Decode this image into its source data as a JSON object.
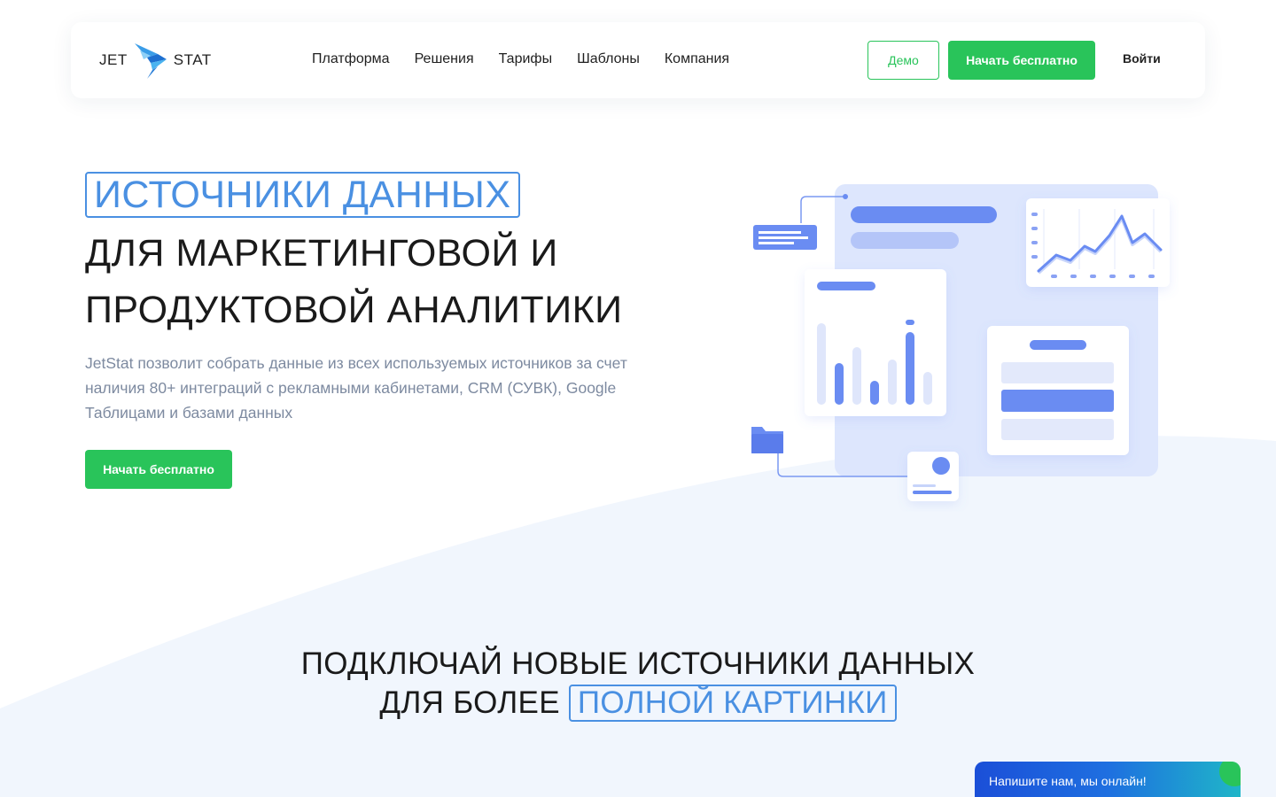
{
  "brand": {
    "left": "JET",
    "right": "STAT",
    "accent_color": "#4a90e2"
  },
  "nav": {
    "links": [
      "Платформа",
      "Решения",
      "Тарифы",
      "Шаблоны",
      "Компания"
    ],
    "demo_label": "Демо",
    "start_label": "Начать бесплатно",
    "login_label": "Войти"
  },
  "hero": {
    "accent_title": "ИСТОЧНИКИ ДАННЫХ",
    "title_line_1": "ДЛЯ МАРКЕТИНГОВОЙ И",
    "title_line_2": "ПРОДУКТОВОЙ АНАЛИТИКИ",
    "description": "JetStat позволит собрать данные из всех используемых источников за счет наличия 80+ интеграций с рекламными кабинетами, CRM (СУВК), Google Таблицами и базами данных",
    "cta_label": "Начать бесплатно"
  },
  "section2": {
    "line_1": "ПОДКЛЮЧАЙ НОВЫЕ ИСТОЧНИКИ ДАННЫХ",
    "line_2_prefix": "ДЛЯ БОЛЕЕ",
    "line_2_accent": "ПОЛНОЙ КАРТИНКИ"
  },
  "chat": {
    "label": "Напишите нам, мы онлайн!"
  },
  "colors": {
    "green": "#29c45a",
    "blue": "#4a90e2",
    "illustration_blue": "#6a8cf2"
  }
}
